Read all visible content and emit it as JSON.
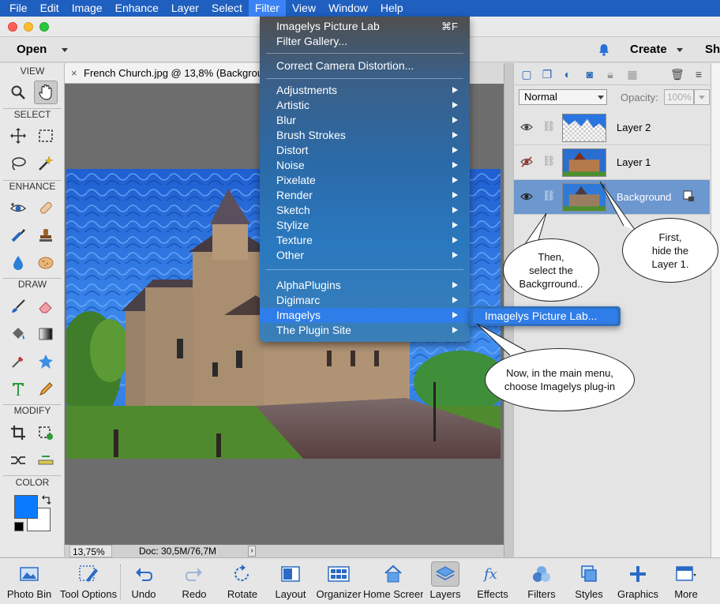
{
  "menubar": {
    "items": [
      "File",
      "Edit",
      "Image",
      "Enhance",
      "Layer",
      "Select",
      "Filter",
      "View",
      "Window",
      "Help"
    ],
    "active": "Filter"
  },
  "actionbar": {
    "open_label": "Open",
    "create_label": "Create",
    "share_label": "Sh"
  },
  "toolbox": {
    "sections": [
      "VIEW",
      "SELECT",
      "ENHANCE",
      "DRAW",
      "MODIFY",
      "COLOR"
    ],
    "foreground_color": "#0a7bff",
    "background_color": "#ffffff"
  },
  "document": {
    "tab_close": "×",
    "tab_title": "French Church.jpg @ 13,8% (Background",
    "zoom": "13,75%",
    "doc_size": "Doc: 30,5M/76,7M",
    "status_arrow": "›"
  },
  "filter_menu": {
    "top_items": [
      {
        "label": "Imagelys Picture Lab",
        "shortcut": "⌘F"
      },
      {
        "label": "Filter Gallery..."
      },
      {
        "label": "Correct Camera Distortion..."
      }
    ],
    "category_items": [
      "Adjustments",
      "Artistic",
      "Blur",
      "Brush Strokes",
      "Distort",
      "Noise",
      "Pixelate",
      "Render",
      "Sketch",
      "Stylize",
      "Texture",
      "Other"
    ],
    "plugin_items": [
      "AlphaPlugins",
      "Digimarc",
      "Imagelys",
      "The Plugin Site"
    ],
    "highlighted": "Imagelys",
    "submenu_item": "Imagelys Picture Lab..."
  },
  "layers_panel": {
    "blend_mode": "Normal",
    "opacity_label": "Opacity:",
    "opacity_value": "100%",
    "layers": [
      {
        "name": "Layer 2",
        "visible": true,
        "selected": false
      },
      {
        "name": "Layer 1",
        "visible": false,
        "selected": false
      },
      {
        "name": "Background",
        "visible": true,
        "selected": true
      }
    ]
  },
  "callouts": {
    "first": "First,\nhide the\nLayer 1.",
    "then": "Then,\nselect the\nBackgrround..",
    "now": "Now, in the main menu,\nchoose Imagelys plug-in"
  },
  "taskbar": {
    "items": [
      {
        "label": "Photo Bin",
        "icon": "photo-bin-icon"
      },
      {
        "label": "Tool Options",
        "icon": "tool-options-icon"
      },
      {
        "label": "Undo",
        "icon": "undo-icon"
      },
      {
        "label": "Redo",
        "icon": "redo-icon"
      },
      {
        "label": "Rotate",
        "icon": "rotate-icon"
      },
      {
        "label": "Layout",
        "icon": "layout-icon"
      },
      {
        "label": "Organizer",
        "icon": "organizer-icon"
      },
      {
        "label": "Home Screen",
        "icon": "home-icon"
      },
      {
        "label": "Layers",
        "icon": "layers-icon"
      },
      {
        "label": "Effects",
        "icon": "effects-icon"
      },
      {
        "label": "Filters",
        "icon": "filters-icon"
      },
      {
        "label": "Styles",
        "icon": "styles-icon"
      },
      {
        "label": "Graphics",
        "icon": "graphics-icon"
      },
      {
        "label": "More",
        "icon": "more-icon"
      }
    ]
  },
  "colors": {
    "accent": "#2f7de8",
    "menubar": "#1f5fbf",
    "selected_layer": "#6c97cf"
  }
}
